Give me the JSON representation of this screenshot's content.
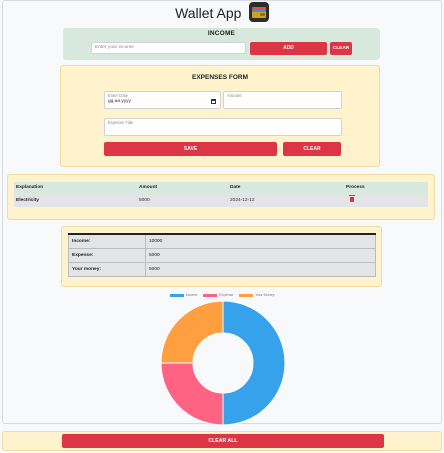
{
  "header": {
    "title": "Wallet App",
    "icon": "wallet-icon"
  },
  "income": {
    "title": "INCOME",
    "placeholder": "Enter your income",
    "add_label": "ADD",
    "clear_label": "CLEAR"
  },
  "expenses_form": {
    "title": "EXPENSES FORM",
    "date_label": "Enter Date",
    "date_value": "gg.aa.yyyy",
    "amount_label": "Amount",
    "explanation_label": "Expense Title",
    "save_label": "SAVE",
    "clear_label": "CLEAR"
  },
  "expenses_table": {
    "headers": [
      "Explanation",
      "Amount",
      "Date",
      "Process"
    ],
    "rows": [
      {
        "explanation": "Electricity",
        "amount": "5000",
        "date": "2024-12-12",
        "process": "trash-icon"
      }
    ]
  },
  "summary": {
    "rows": [
      {
        "label": "Income:",
        "value": "10000"
      },
      {
        "label": "Expense:",
        "value": "5000"
      },
      {
        "label": "Your money:",
        "value": "5000"
      }
    ]
  },
  "chart_data": {
    "type": "pie",
    "categories": [
      "Income",
      "Expense",
      "Your Money"
    ],
    "values": [
      10000,
      5000,
      5000
    ],
    "colors": [
      "#36a2eb",
      "#ff6384",
      "#ff9f40"
    ],
    "legend": "top"
  },
  "bottom": {
    "clear_all_label": "CLEAR ALL"
  },
  "colors": {
    "danger": "#dc3545",
    "card_yellow": "#fff3cd",
    "card_green": "#d6e9dc"
  }
}
